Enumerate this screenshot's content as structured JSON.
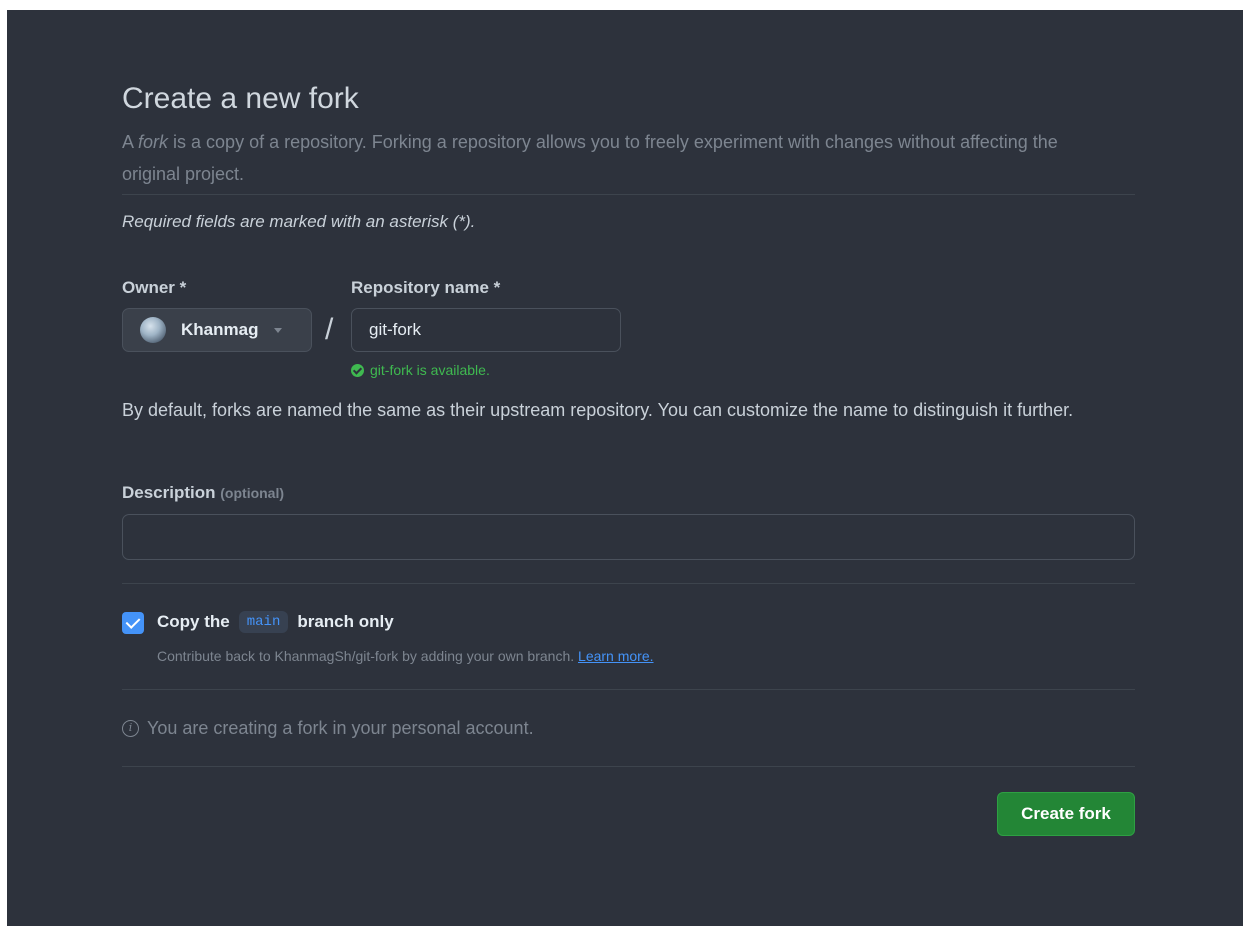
{
  "page_title": "Create a new fork",
  "subtitle": {
    "prefix": "A ",
    "emphasis": "fork",
    "rest": " is a copy of a repository. Forking a repository allows you to freely experiment with changes without affecting the original project."
  },
  "required_note": "Required fields are marked with an asterisk (*).",
  "owner": {
    "label": "Owner *",
    "selected": "Khanmag"
  },
  "separator": "/",
  "repository": {
    "label": "Repository name *",
    "value": "git-fork",
    "availability": "git-fork is available."
  },
  "naming_help": "By default, forks are named the same as their upstream repository. You can customize the name to distinguish it further.",
  "description": {
    "label": "Description",
    "optional": "(optional)",
    "value": ""
  },
  "copy_branch": {
    "checked": true,
    "label_prefix": "Copy the",
    "branch": "main",
    "label_suffix": "branch only",
    "help_text": "Contribute back to KhanmagSh/git-fork by adding your own branch.",
    "learn_more": "Learn more."
  },
  "info_message": "You are creating a fork in your personal account.",
  "submit_label": "Create fork",
  "colors": {
    "background": "#2d323c",
    "accent_green": "#238636",
    "success_text": "#3fb950",
    "link_blue": "#4493f8"
  },
  "icons": {
    "owner_avatar": "avatar-image",
    "owner_dropdown": "caret-down-icon",
    "availability": "check-circle-icon",
    "info": "info-icon"
  }
}
